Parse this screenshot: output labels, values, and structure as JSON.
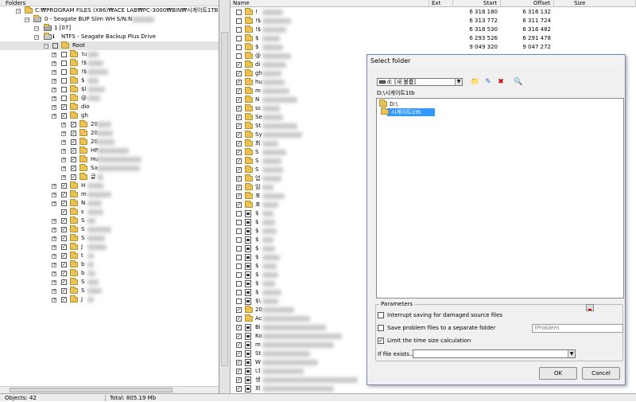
{
  "left_panel": {
    "header": "Folders",
    "path_root": "C:₩PROGRAM FILES (X86)₩ACE LAB₩PC-3000₩BIN₩시게이트1TB",
    "device": "0 - Seagate BUP Slim WH S/N:N",
    "partition_set": "1 [07]",
    "volume": "NTFS - Seagate Backup Plus Drive",
    "root": "Root",
    "items": [
      {
        "label": "!u"
      },
      {
        "label": "!$"
      },
      {
        "label": "!$"
      },
      {
        "label": "$"
      },
      {
        "label": "$I"
      },
      {
        "label": "@"
      },
      {
        "label": "dio"
      },
      {
        "label": "gh"
      },
      {
        "label": "20"
      },
      {
        "label": "20"
      },
      {
        "label": "20"
      },
      {
        "label": "HP"
      },
      {
        "label": "Hu"
      },
      {
        "label": "Sa"
      },
      {
        "label": "글"
      },
      {
        "label": "H"
      },
      {
        "label": "m"
      },
      {
        "label": "N"
      },
      {
        "label": "s"
      },
      {
        "label": "S"
      },
      {
        "label": "S"
      },
      {
        "label": "S"
      },
      {
        "label": "J"
      },
      {
        "label": "t"
      },
      {
        "label": "b"
      },
      {
        "label": "b"
      },
      {
        "label": "S"
      },
      {
        "label": "S"
      },
      {
        "label": "J"
      }
    ]
  },
  "file_list": {
    "columns": [
      "Name",
      "Ext",
      "Start",
      "Offset",
      "Size"
    ],
    "rows": [
      {
        "name": "!",
        "start": "6 318 180",
        "offset": "6 316 132"
      },
      {
        "name": "!$",
        "start": "6 313 772",
        "offset": "6 311 724"
      },
      {
        "name": "!$",
        "start": "6 318 530",
        "offset": "6 316 482"
      },
      {
        "name": "$",
        "start": "6 293 526",
        "offset": "6 291 478"
      },
      {
        "name": "$",
        "start": "9 049 320",
        "offset": "9 047 272"
      },
      {
        "name": "@"
      },
      {
        "name": "di"
      },
      {
        "name": "gh"
      },
      {
        "name": "hu"
      },
      {
        "name": "m"
      },
      {
        "name": "N"
      },
      {
        "name": "sc"
      },
      {
        "name": "Se"
      },
      {
        "name": "St"
      },
      {
        "name": "Sy"
      },
      {
        "name": "회"
      },
      {
        "name": "S"
      },
      {
        "name": "S"
      },
      {
        "name": "S"
      },
      {
        "name": "업"
      },
      {
        "name": "임"
      },
      {
        "name": "포"
      },
      {
        "name": "포"
      },
      {
        "name": "$"
      },
      {
        "name": "$"
      },
      {
        "name": "$"
      },
      {
        "name": "$"
      },
      {
        "name": "$"
      },
      {
        "name": "$"
      },
      {
        "name": "$"
      },
      {
        "name": "$"
      },
      {
        "name": "$"
      },
      {
        "name": "$"
      },
      {
        "name": "$\\"
      },
      {
        "name": "20"
      },
      {
        "name": "Ac"
      },
      {
        "name": "Bi"
      },
      {
        "name": "Ko"
      },
      {
        "name": "m"
      },
      {
        "name": "St"
      },
      {
        "name": "W"
      },
      {
        "name": "너"
      },
      {
        "name": "생"
      },
      {
        "name": "회"
      }
    ]
  },
  "status_bar": {
    "objects": "Objects: 42",
    "total": "Total: 805.19 Mb"
  },
  "dialog": {
    "title": "Select folder",
    "drive": "d: [새 볼륨]",
    "current_path": "D:\\시게이트1tb",
    "tree": [
      {
        "label": "D:\\"
      },
      {
        "label": "시게이트1tb"
      }
    ],
    "parameters": {
      "legend": "Parameters",
      "interrupt_label": "Interrupt saving for damaged source files",
      "interrupt_checked": false,
      "save_problem_label": "Save problem files to a separate folder",
      "save_problem_checked": false,
      "problem_folder": "!Problem",
      "limit_label": "Limit the time size calculation",
      "limit_checked": true,
      "if_exists_label": "If file exists...",
      "if_exists_value": ""
    },
    "ok_label": "OK",
    "cancel_label": "Cancel"
  }
}
